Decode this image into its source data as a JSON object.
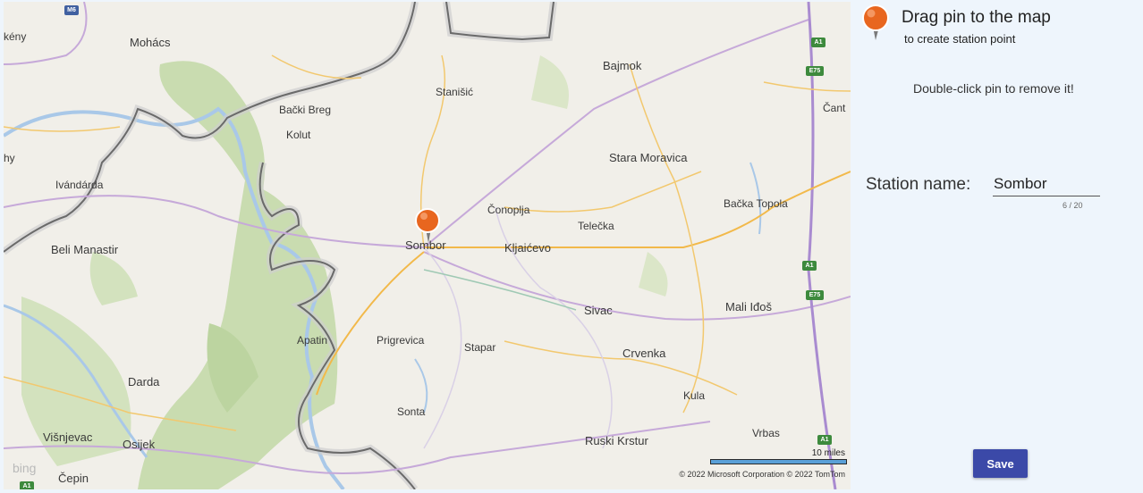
{
  "map": {
    "places": [
      {
        "id": "mohacs",
        "label": "Mohács"
      },
      {
        "id": "keny",
        "label": "kény"
      },
      {
        "id": "bajmok",
        "label": "Bajmok"
      },
      {
        "id": "stanisic",
        "label": "Stanišić"
      },
      {
        "id": "backi-breg",
        "label": "Bački Breg"
      },
      {
        "id": "kolut",
        "label": "Kolut"
      },
      {
        "id": "stara-moravica",
        "label": "Stara Moravica"
      },
      {
        "id": "ivandarda",
        "label": "Ivándárda"
      },
      {
        "id": "conoplja",
        "label": "Čonoplja"
      },
      {
        "id": "telecka",
        "label": "Telečka"
      },
      {
        "id": "backa-topola",
        "label": "Bačka Topola"
      },
      {
        "id": "sombor",
        "label": "Sombor"
      },
      {
        "id": "kljajicevo",
        "label": "Kljaićevo"
      },
      {
        "id": "beli-manastir",
        "label": "Beli Manastir"
      },
      {
        "id": "sivac",
        "label": "Sivac"
      },
      {
        "id": "mali-idos",
        "label": "Mali Iđoš"
      },
      {
        "id": "apatin",
        "label": "Apatin"
      },
      {
        "id": "prigrevica",
        "label": "Prigrevica"
      },
      {
        "id": "stapar",
        "label": "Stapar"
      },
      {
        "id": "crvenka",
        "label": "Crvenka"
      },
      {
        "id": "darda",
        "label": "Darda"
      },
      {
        "id": "kula",
        "label": "Kula"
      },
      {
        "id": "sonta",
        "label": "Sonta"
      },
      {
        "id": "visnjevac",
        "label": "Višnjevac"
      },
      {
        "id": "osijek",
        "label": "Osijek"
      },
      {
        "id": "ruski-krstur",
        "label": "Ruski Krstur"
      },
      {
        "id": "vrbas",
        "label": "Vrbas"
      },
      {
        "id": "cepin",
        "label": "Čepin"
      },
      {
        "id": "cant",
        "label": "Čant"
      },
      {
        "id": "hy",
        "label": "hy"
      }
    ],
    "shields": {
      "a1": "A1",
      "e75": "E75",
      "m6": "M6"
    },
    "scale": "10 miles",
    "copyright": "© 2022 Microsoft Corporation   © 2022 TomTom",
    "logo": "bing"
  },
  "panel": {
    "drag_title": "Drag pin to the map",
    "drag_subtitle": "to create station point",
    "remove_hint": "Double-click pin to remove it!",
    "station_label": "Station name:",
    "station_value": "Sombor",
    "counter": "6 / 20",
    "save_label": "Save"
  },
  "colors": {
    "accent": "#3b49a8",
    "pin": "#e8661f",
    "background": "#eef5fc"
  },
  "icons": {
    "pin": "map-pin-icon"
  }
}
